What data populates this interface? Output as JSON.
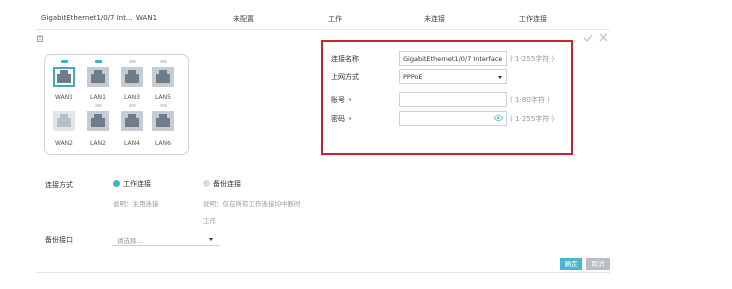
{
  "header": {
    "interface": "GigabitEthernet1/0/7 Int...",
    "wan": "WAN1",
    "config_status": "未配置",
    "work": "工作",
    "conn_status": "未连接",
    "work_conn": "工作连接"
  },
  "ports": {
    "top": [
      {
        "label": "WAN1",
        "selected": true,
        "led": "active"
      },
      {
        "label": "LAN1",
        "selected": false,
        "led": "active"
      },
      {
        "label": "LAN3",
        "selected": false,
        "led": "off"
      },
      {
        "label": "LAN5",
        "selected": false,
        "led": "off"
      }
    ],
    "bottom": [
      {
        "label": "WAN2",
        "selected": false,
        "style": "light"
      },
      {
        "label": "LAN2",
        "selected": false,
        "style": "dark"
      },
      {
        "label": "LAN4",
        "selected": false,
        "style": "dark"
      },
      {
        "label": "LAN6",
        "selected": false,
        "style": "dark"
      }
    ]
  },
  "form": {
    "conn_name_label": "连接名称",
    "conn_name_value": "GigabitEthernet1/0/7 Interface",
    "conn_name_hint": "( 1-255字符 )",
    "method_label": "上网方式",
    "method_value": "PPPoE",
    "account_label": "账号",
    "account_value": "",
    "account_hint": "( 1-80字符 )",
    "password_label": "密码",
    "password_value": "",
    "password_hint": "( 1-255字符 )",
    "required_mark": "•"
  },
  "options": {
    "conn_type_label": "连接方式",
    "work_conn": "工作连接",
    "work_desc": "说明：主用连接",
    "backup_conn": "备份连接",
    "backup_desc_1": "说明：仅在所有工作连接均中断时",
    "backup_desc_2": "工作",
    "backup_iface_label": "备份接口",
    "backup_iface_placeholder": "请选择..."
  },
  "buttons": {
    "ok": "确定",
    "cancel": "取消"
  },
  "colors": {
    "accent": "#3fb3c7",
    "highlight_border": "#c0282d",
    "required": "#3a9fd6"
  }
}
